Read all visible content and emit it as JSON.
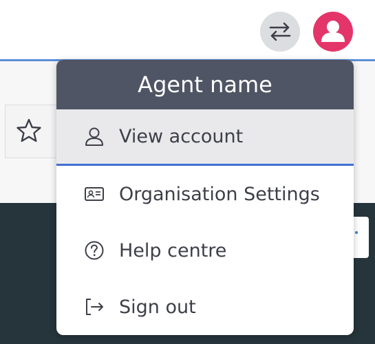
{
  "header": {
    "icons": {
      "switch": "swap-arrows-icon",
      "avatar": "user-avatar-icon",
      "star": "star-icon"
    },
    "avatar_color": "#e4356a"
  },
  "menu": {
    "title": "Agent name",
    "header_color": "#4f5564",
    "items": [
      {
        "label": "View account",
        "icon": "user-icon",
        "active": true
      },
      {
        "label": "Organisation Settings",
        "icon": "id-card-icon",
        "active": false
      },
      {
        "label": "Help centre",
        "icon": "help-circle-icon",
        "active": false
      },
      {
        "label": "Sign out",
        "icon": "sign-out-icon",
        "active": false
      }
    ],
    "active_accent": "#3f6fd0"
  }
}
